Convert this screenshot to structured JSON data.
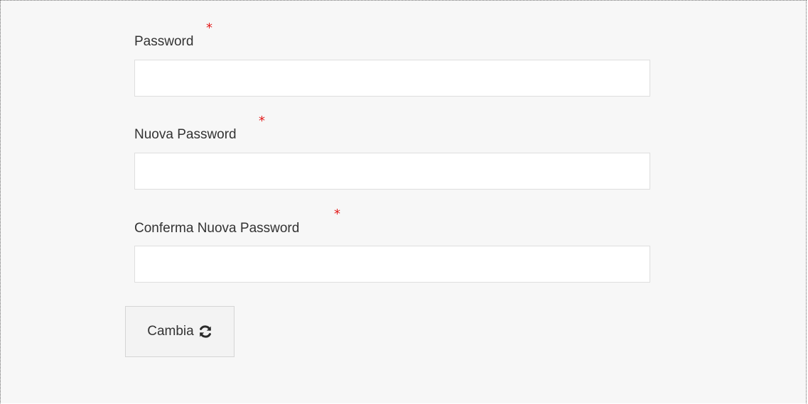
{
  "form": {
    "fields": [
      {
        "label": "Password",
        "required_mark": "*",
        "value": "",
        "placeholder": ""
      },
      {
        "label": "Nuova Password",
        "required_mark": "*",
        "value": "",
        "placeholder": ""
      },
      {
        "label": "Conferma Nuova Password",
        "required_mark": "*",
        "value": "",
        "placeholder": ""
      }
    ],
    "submit": {
      "label": "Cambia",
      "icon": "refresh-icon"
    }
  },
  "colors": {
    "background": "#f7f7f7",
    "required_mark": "#e31b1b",
    "input_border": "#dedede",
    "button_background": "#f3f3f3"
  }
}
